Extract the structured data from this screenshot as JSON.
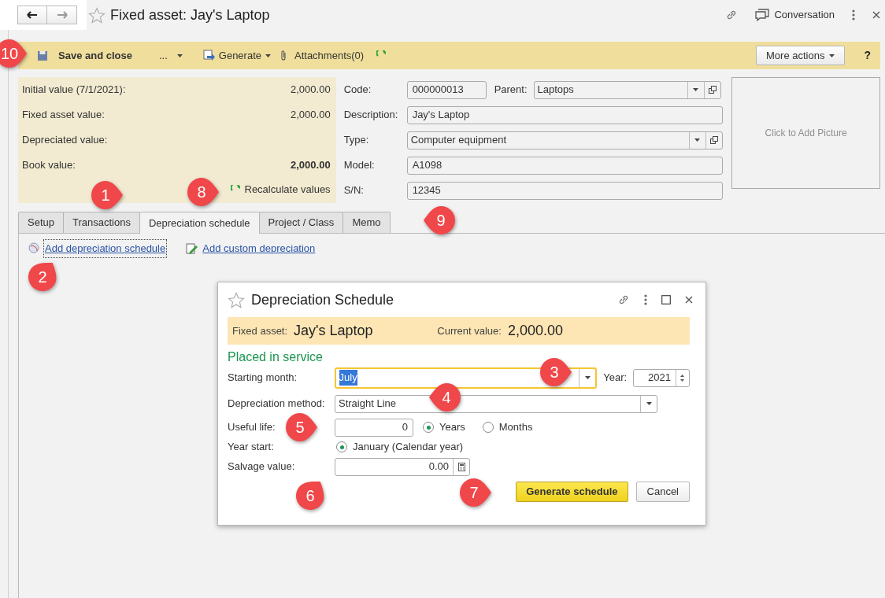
{
  "window": {
    "title": "Fixed asset: Jay's Laptop",
    "conversation": "Conversation"
  },
  "toolbar": {
    "save": "Save and close",
    "more": "...",
    "generate": "Generate",
    "attachments": "Attachments(0)",
    "more_actions": "More actions",
    "help": "?"
  },
  "summary": {
    "rows": [
      {
        "label": "Initial value (7/1/2021):",
        "value": "2,000.00",
        "bold": false
      },
      {
        "label": "Fixed asset value:",
        "value": "2,000.00",
        "bold": false
      },
      {
        "label": "Depreciated value:"
      },
      {
        "label": "Book value:",
        "value": "2,000.00",
        "bold": true
      }
    ],
    "recalculate": "Recalculate values"
  },
  "fields": {
    "code": {
      "label": "Code:",
      "value": "000000013"
    },
    "parent": {
      "label": "Parent:",
      "value": "Laptops"
    },
    "description": {
      "label": "Description:",
      "value": "Jay's Laptop"
    },
    "type": {
      "label": "Type:",
      "value": "Computer equipment"
    },
    "model": {
      "label": "Model:",
      "value": "A1098"
    },
    "sn": {
      "label": "S/N:",
      "value": "12345"
    }
  },
  "picture": {
    "placeholder": "Click to Add Picture"
  },
  "tabs": [
    {
      "label": "Setup",
      "selected": false
    },
    {
      "label": "Transactions",
      "selected": false
    },
    {
      "label": "Depreciation schedule",
      "selected": true
    },
    {
      "label": "Project / Class",
      "selected": false
    },
    {
      "label": "Memo",
      "selected": false
    }
  ],
  "links": [
    {
      "label": "Add depreciation schedule",
      "focused": true,
      "kind": "globe"
    },
    {
      "label": "Add custom depreciation",
      "focused": false,
      "kind": "edit"
    }
  ],
  "dialog": {
    "title": "Depreciation Schedule",
    "asset_label": "Fixed asset:",
    "asset": "Jay's Laptop",
    "current_label": "Current value:",
    "current": "2,000.00",
    "section": "Placed in service",
    "starting_month": {
      "label": "Starting month:",
      "value": "July",
      "focused": true
    },
    "year": {
      "label": "Year:",
      "value": "2021"
    },
    "method": {
      "label": "Depreciation method:",
      "value": "Straight Line"
    },
    "useful_life": {
      "label": "Useful life:",
      "value": "0",
      "units": [
        {
          "label": "Years",
          "selected": true
        },
        {
          "label": "Months",
          "selected": false
        }
      ]
    },
    "year_start": {
      "label": "Year start:",
      "options": [
        {
          "label": "January (Calendar year)",
          "selected": true
        }
      ]
    },
    "salvage": {
      "label": "Salvage value:",
      "value": "0.00"
    },
    "buttons": [
      {
        "label": "Generate schedule",
        "kind": "primary"
      },
      {
        "label": "Cancel",
        "kind": "default"
      }
    ]
  },
  "callouts": [
    {
      "label": "10"
    },
    {
      "label": "1"
    },
    {
      "label": "8"
    },
    {
      "label": "9"
    },
    {
      "label": "2"
    },
    {
      "label": "3"
    },
    {
      "label": "4"
    },
    {
      "label": "5"
    },
    {
      "label": "6"
    },
    {
      "label": "7"
    }
  ]
}
